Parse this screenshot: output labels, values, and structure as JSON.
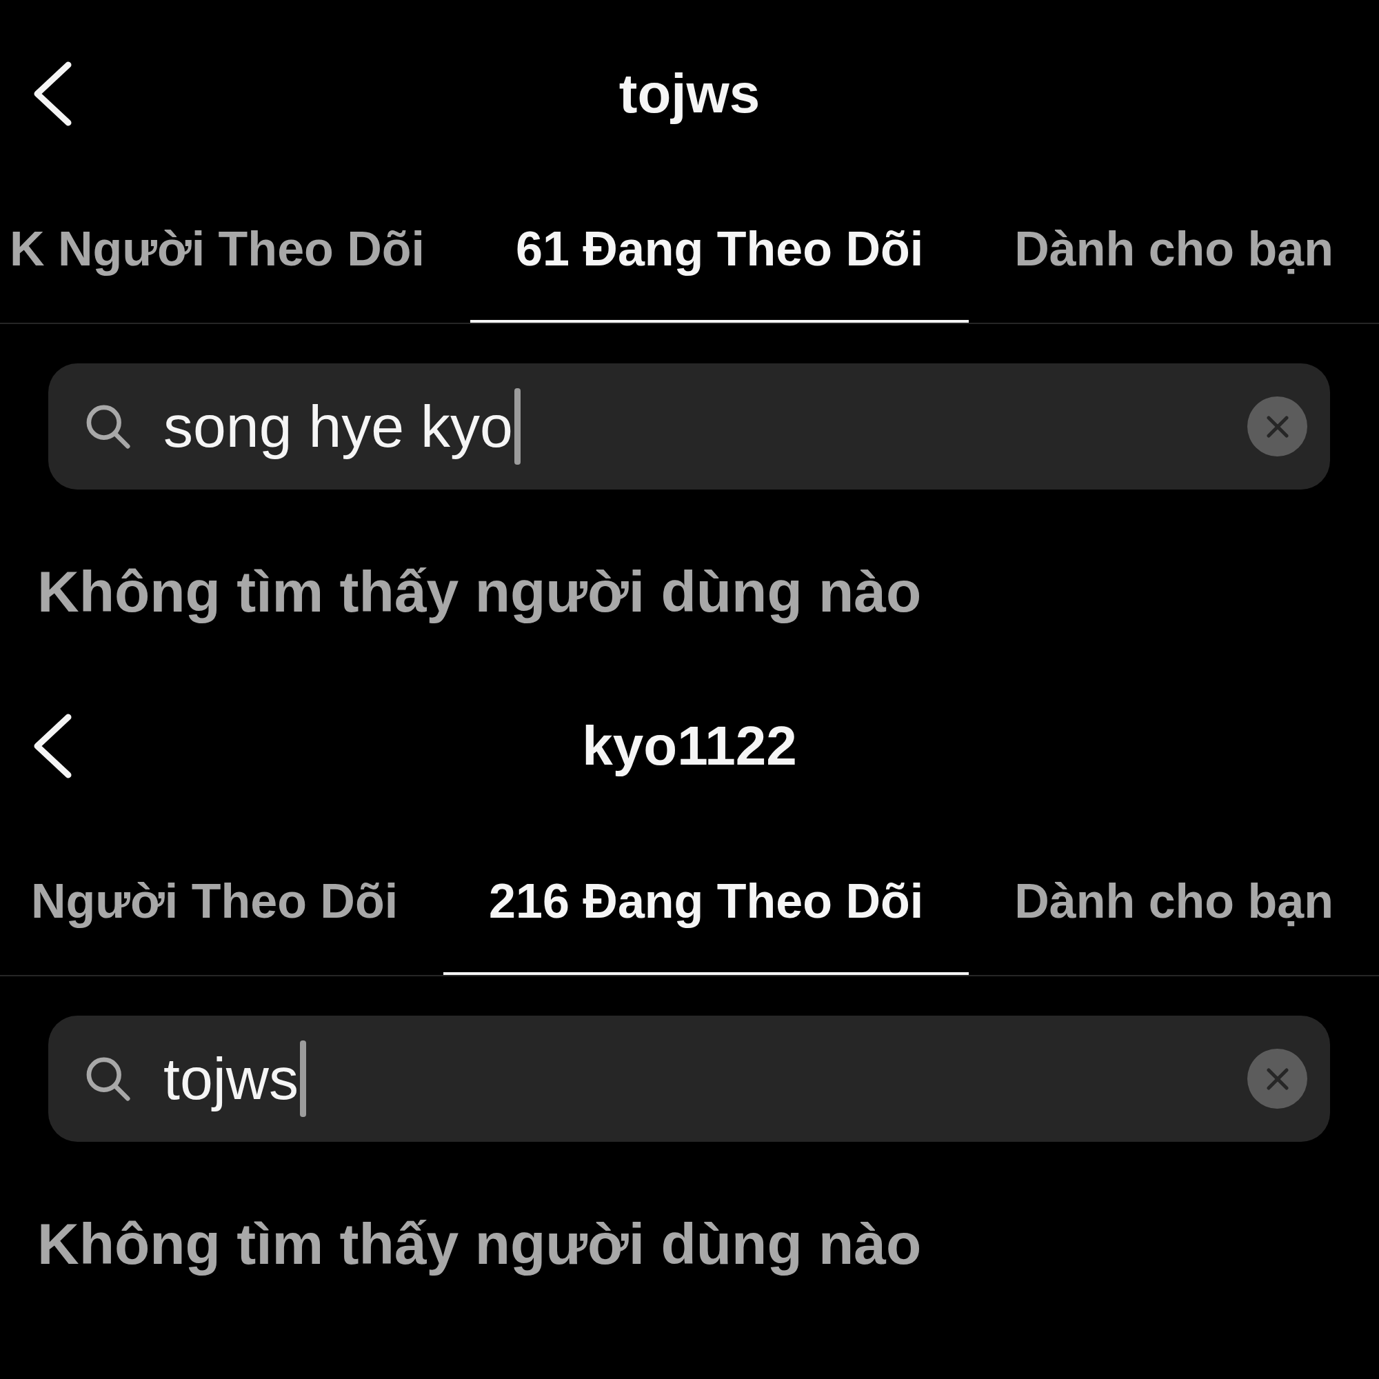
{
  "panels": [
    {
      "header": {
        "title": "tojws"
      },
      "tabs": [
        {
          "label": "K Người Theo Dõi",
          "selected": false
        },
        {
          "label": "61 Đang Theo Dõi",
          "selected": true
        },
        {
          "label": "Dành cho bạn",
          "selected": false
        }
      ],
      "search": {
        "value": "song hye kyo",
        "focused": true
      },
      "empty_message": "Không tìm thấy người dùng nào"
    },
    {
      "header": {
        "title": "kyo1122"
      },
      "tabs": [
        {
          "label": "Người Theo Dõi",
          "selected": false
        },
        {
          "label": "216 Đang Theo Dõi",
          "selected": true
        },
        {
          "label": "Dành cho bạn",
          "selected": false
        }
      ],
      "search": {
        "value": "tojws",
        "focused": true
      },
      "empty_message": "Không tìm thấy người dùng nào"
    }
  ]
}
